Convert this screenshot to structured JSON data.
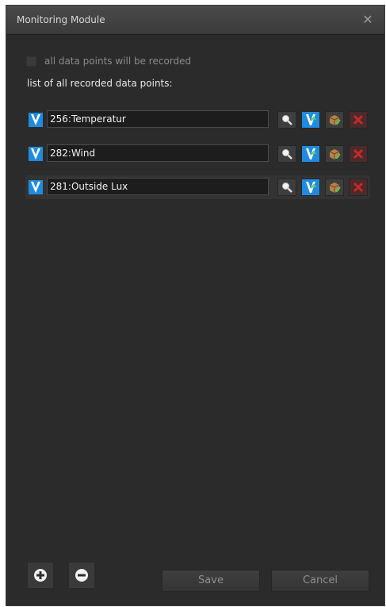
{
  "dialog": {
    "title": "Monitoring Module",
    "close_icon": "close-icon"
  },
  "record_all": {
    "checked": false,
    "label": "all data points will be recorded"
  },
  "list_label": "list of all recorded data points:",
  "data_points": [
    {
      "value": "256:Temperatur",
      "selected": false
    },
    {
      "value": "282:Wind",
      "selected": false
    },
    {
      "value": "281:Outside Lux",
      "selected": true
    }
  ],
  "row_icons": [
    "v-icon",
    "magnifier-icon",
    "chart-icon",
    "package-icon",
    "delete-icon"
  ],
  "bottom": {
    "add_icon": "plus-circle-icon",
    "remove_icon": "minus-circle-icon",
    "save_label": "Save",
    "cancel_label": "Cancel"
  },
  "colors": {
    "dialog_bg": "#2b2b2b",
    "accent_blue": "#1f8be0",
    "delete_red": "#c62828",
    "text_light": "#e8e8e8",
    "text_muted": "#8a8a8a"
  }
}
